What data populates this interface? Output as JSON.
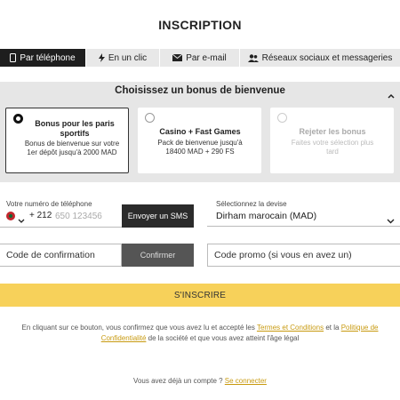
{
  "page": {
    "title": "INSCRIPTION"
  },
  "tabs": [
    {
      "label": "Par téléphone",
      "icon": "phone-icon",
      "active": true
    },
    {
      "label": "En un clic",
      "icon": "lightning-icon"
    },
    {
      "label": "Par e-mail",
      "icon": "envelope-icon"
    },
    {
      "label": "Réseaux sociaux et messageries",
      "icon": "people-icon"
    }
  ],
  "bonus": {
    "heading": "Choisissez un bonus de bienvenue",
    "options": [
      {
        "title": "Bonus pour les paris sportifs",
        "desc": "Bonus de bienvenue sur votre 1er dépôt jusqu'à 2000 MAD",
        "selected": true
      },
      {
        "title": "Casino + Fast Games",
        "desc": "Pack de bienvenue jusqu'à 18400 MAD + 290 FS",
        "selected": false
      },
      {
        "title": "Rejeter les bonus",
        "desc": "Faites votre sélection plus tard",
        "selected": false
      }
    ]
  },
  "phone": {
    "label": "Votre numéro de téléphone",
    "country_code": "+ 212",
    "placeholder": "650 123456",
    "send_sms": "Envoyer un SMS"
  },
  "currency": {
    "label": "Sélectionnez la devise",
    "value": "Dirham marocain (MAD)"
  },
  "confirmation": {
    "placeholder": "Code de confirmation",
    "button": "Confirmer"
  },
  "promo": {
    "placeholder": "Code promo (si vous en avez un)"
  },
  "submit": {
    "label": "S'INSCRIRE"
  },
  "legal": {
    "prefix": "En cliquant sur ce bouton, vous confirmez que vous avez lu et accepté les",
    "terms": "Termes et Conditions",
    "and": "et la",
    "privacy": "Politique de Confidentialité",
    "suffix": "de la société et que vous avez atteint l'âge légal"
  },
  "login": {
    "prompt": "Vous avez déjà un compte ?",
    "link": "Se connecter"
  },
  "colors": {
    "accent_yellow": "#f7d15a",
    "link": "#c89a10",
    "dark": "#1e1e1e"
  }
}
